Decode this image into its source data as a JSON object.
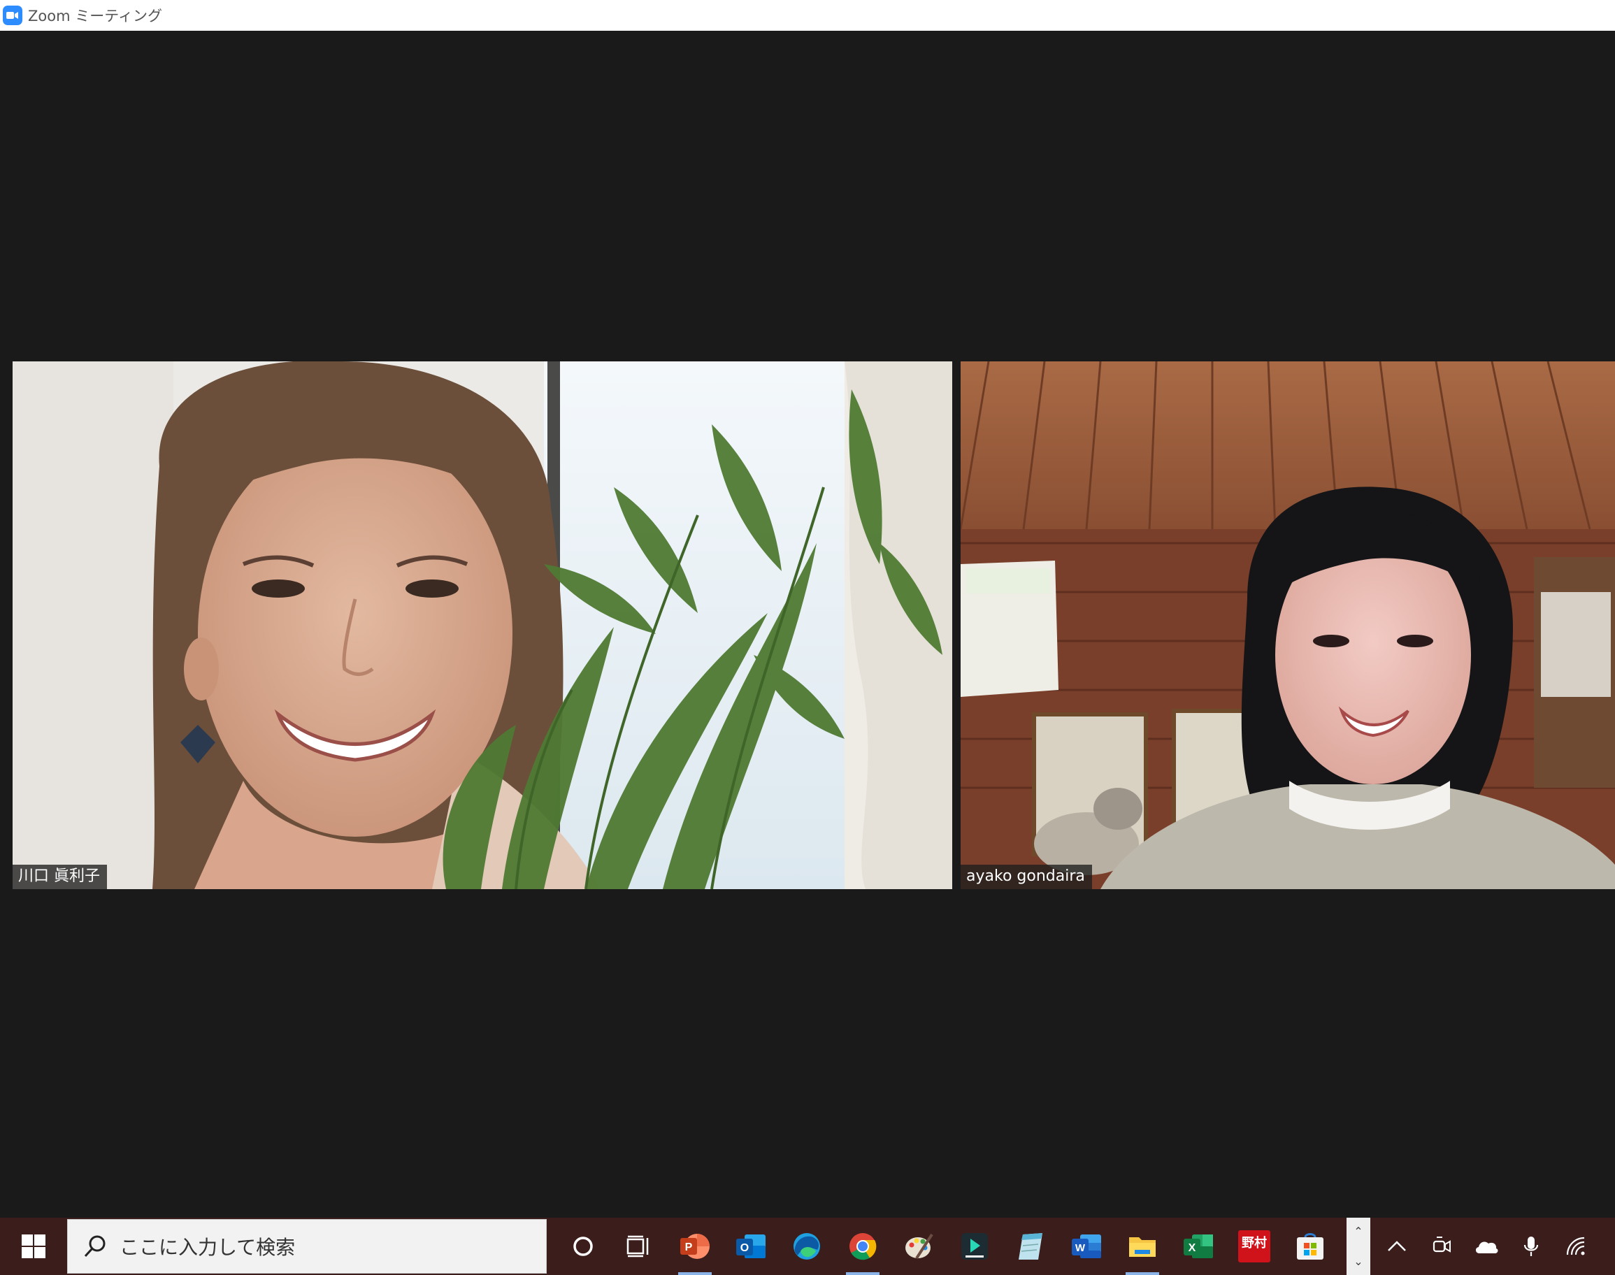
{
  "window": {
    "title": "Zoom ミーティング",
    "app_icon": "zoom-camera-icon",
    "accent": "#2d8cff"
  },
  "meeting": {
    "background": "#1a1a1a",
    "participants": [
      {
        "name": "川口 眞利子"
      },
      {
        "name": "ayako gondaira"
      }
    ]
  },
  "taskbar": {
    "background": "#3b1e1c",
    "search": {
      "placeholder": "ここに入力して検索",
      "icon": "search-icon"
    },
    "pinned": [
      {
        "id": "cortana",
        "icon": "cortana-circle-icon"
      },
      {
        "id": "task-view",
        "icon": "task-view-icon"
      },
      {
        "id": "powerpoint",
        "icon": "powerpoint-icon",
        "letter": "P",
        "color": "#d24726",
        "active": true
      },
      {
        "id": "outlook",
        "icon": "outlook-icon",
        "letter": "O",
        "color": "#0a64c8"
      },
      {
        "id": "edge",
        "icon": "edge-icon",
        "color": "#1fa0e0"
      },
      {
        "id": "chrome",
        "icon": "chrome-icon",
        "active": true
      },
      {
        "id": "paint",
        "icon": "paint-palette-icon"
      },
      {
        "id": "filmora",
        "icon": "filmora-icon",
        "color": "#1d2b33"
      },
      {
        "id": "notepad",
        "icon": "notepad-icon"
      },
      {
        "id": "word",
        "icon": "word-icon",
        "letter": "W",
        "color": "#2b579a"
      },
      {
        "id": "file-explorer",
        "icon": "folder-icon",
        "active": true
      },
      {
        "id": "excel",
        "icon": "excel-icon",
        "letter": "X",
        "color": "#1e7145"
      },
      {
        "id": "nomura",
        "icon": "nomura-online-icon",
        "letter": "野村",
        "color": "#d0121b"
      },
      {
        "id": "store",
        "icon": "microsoft-store-icon"
      }
    ],
    "tray": [
      {
        "id": "show-hidden",
        "icon": "chevron-up-icon"
      },
      {
        "id": "meet-now",
        "icon": "meet-now-icon"
      },
      {
        "id": "onedrive",
        "icon": "onedrive-cloud-icon"
      },
      {
        "id": "microphone",
        "icon": "microphone-icon"
      },
      {
        "id": "wifi",
        "icon": "wifi-icon"
      }
    ]
  }
}
